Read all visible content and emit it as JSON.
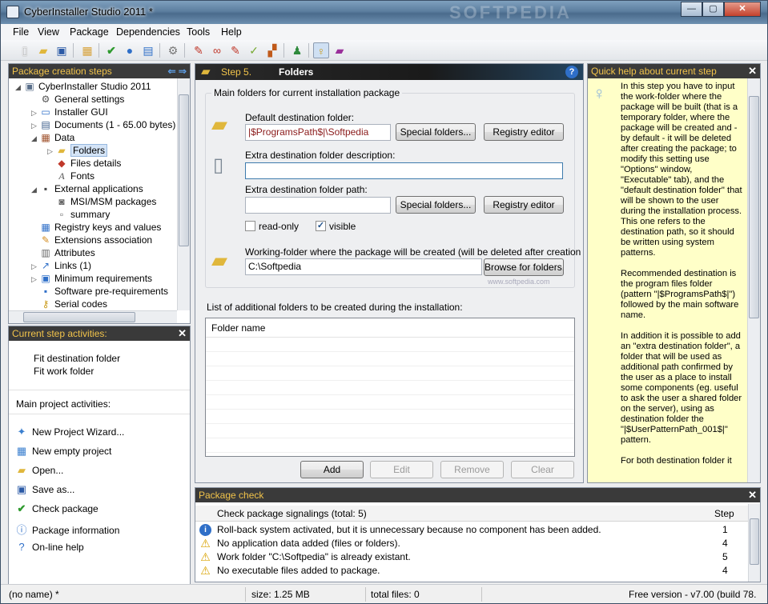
{
  "window": {
    "title": "CyberInstaller Studio 2011 *",
    "watermark": "SOFTPEDIA"
  },
  "menu": [
    "File",
    "View",
    "Package",
    "Dependencies",
    "Tools",
    "Help"
  ],
  "left_panel": {
    "title": "Package creation steps",
    "tree": [
      {
        "label": "CyberInstaller Studio 2011",
        "icon": "computer-icon"
      },
      {
        "label": "General settings",
        "icon": "gear-icon"
      },
      {
        "label": "Installer GUI",
        "icon": "window-icon"
      },
      {
        "label": "Documents (1 - 65.00 bytes)",
        "icon": "document-icon"
      },
      {
        "label": "Data",
        "icon": "box-icon"
      },
      {
        "label": "Folders",
        "icon": "folder-icon"
      },
      {
        "label": "Files details",
        "icon": "files-icon"
      },
      {
        "label": "Fonts",
        "icon": "font-icon"
      },
      {
        "label": "External applications",
        "icon": "app-icon"
      },
      {
        "label": "MSI/MSM packages",
        "icon": "msi-icon"
      },
      {
        "label": "summary",
        "icon": "summary-icon"
      },
      {
        "label": "Registry keys and values",
        "icon": "registry-icon"
      },
      {
        "label": "Extensions association",
        "icon": "extension-icon"
      },
      {
        "label": "Attributes",
        "icon": "attributes-icon"
      },
      {
        "label": "Links (1)",
        "icon": "link-icon"
      },
      {
        "label": "Minimum requirements",
        "icon": "requirements-icon"
      },
      {
        "label": "Software pre-requirements",
        "icon": "prereq-icon"
      },
      {
        "label": "Serial codes",
        "icon": "key-icon"
      }
    ]
  },
  "activities": {
    "title": "Current step activities:",
    "step_items": [
      "Fit destination folder",
      "Fit work folder"
    ],
    "main_title": "Main project activities:",
    "main_items": [
      {
        "label": "New Project Wizard...",
        "icon": "wizard-icon"
      },
      {
        "label": "New empty project",
        "icon": "new-project-icon"
      },
      {
        "label": "Open...",
        "icon": "open-folder-icon"
      },
      {
        "label": "Save as...",
        "icon": "save-as-icon"
      },
      {
        "label": "Check package",
        "icon": "check-icon"
      },
      {
        "label": "Package information",
        "icon": "info-icon"
      },
      {
        "label": "On-line help",
        "icon": "help-icon"
      }
    ]
  },
  "step": {
    "number": "Step 5.",
    "name": "Folders",
    "group_title": "Main folders for current installation package",
    "default_dest_label": "Default destination folder:",
    "default_dest_value": "|$ProgramsPath$|\\Softpedia",
    "special_folders_btn": "Special folders...",
    "registry_editor_btn": "Registry editor",
    "extra_desc_label": "Extra destination folder description:",
    "extra_desc_value": "",
    "extra_path_label": "Extra destination folder path:",
    "extra_path_value": "",
    "readonly_label": "read-only",
    "visible_label": "visible",
    "working_folder_label": "Working-folder where the package will be created (will be deleted after creation",
    "working_folder_value": "C:\\Softpedia",
    "browse_btn": "Browse for folders...",
    "list_label": "List of additional folders to be created during the installation:",
    "list_header": "Folder name",
    "add_btn": "Add",
    "edit_btn": "Edit",
    "remove_btn": "Remove",
    "clear_btn": "Clear",
    "watermark": "www.softpedia.com"
  },
  "quick_help": {
    "title": "Quick help about current step",
    "text": "In this step you have to input the work-folder where the package will be built (that is a temporary folder, where the package will be created and - by default - it will be deleted after creating the package; to modify this setting use \"Options\" window, \"Executable\" tab), and the \"default destination folder\" that will be shown to the user during the installation process. This one refers to the destination path, so it should be written using system patterns.\n\nRecommended destination is the program files folder (pattern \"|$ProgramsPath$|\") followed by the main software name.\n\nIn addition it is possible to add an \"extra destination folder\", a folder that will be used as additional path confirmed by the user as a place to install some components (eg. useful to ask the user a shared folder on the server), using as destination folder the \"|$UserPatternPath_001$|\" pattern.\n\nFor both destination folder it"
  },
  "package_check": {
    "title": "Package check",
    "header": "Check package signalings (total: 5)",
    "step_col": "Step",
    "rows": [
      {
        "type": "info",
        "text": "Roll-back system activated, but it is unnecessary because no component has been added.",
        "step": "1"
      },
      {
        "type": "warning",
        "text": "No application data added (files or folders).",
        "step": "4"
      },
      {
        "type": "warning",
        "text": "Work folder \"C:\\Softpedia\" is already existant.",
        "step": "5"
      },
      {
        "type": "warning",
        "text": "No executable files added to package.",
        "step": "4"
      }
    ]
  },
  "status": {
    "name": "(no name) *",
    "size": "size: 1.25 MB",
    "files": "total files: 0",
    "version": "Free version - v7.00 (build 78."
  },
  "colors": {
    "panel_header_bg": "#3a3a3a",
    "panel_header_text": "#f1c34a",
    "help_bg": "#ffffc8"
  }
}
